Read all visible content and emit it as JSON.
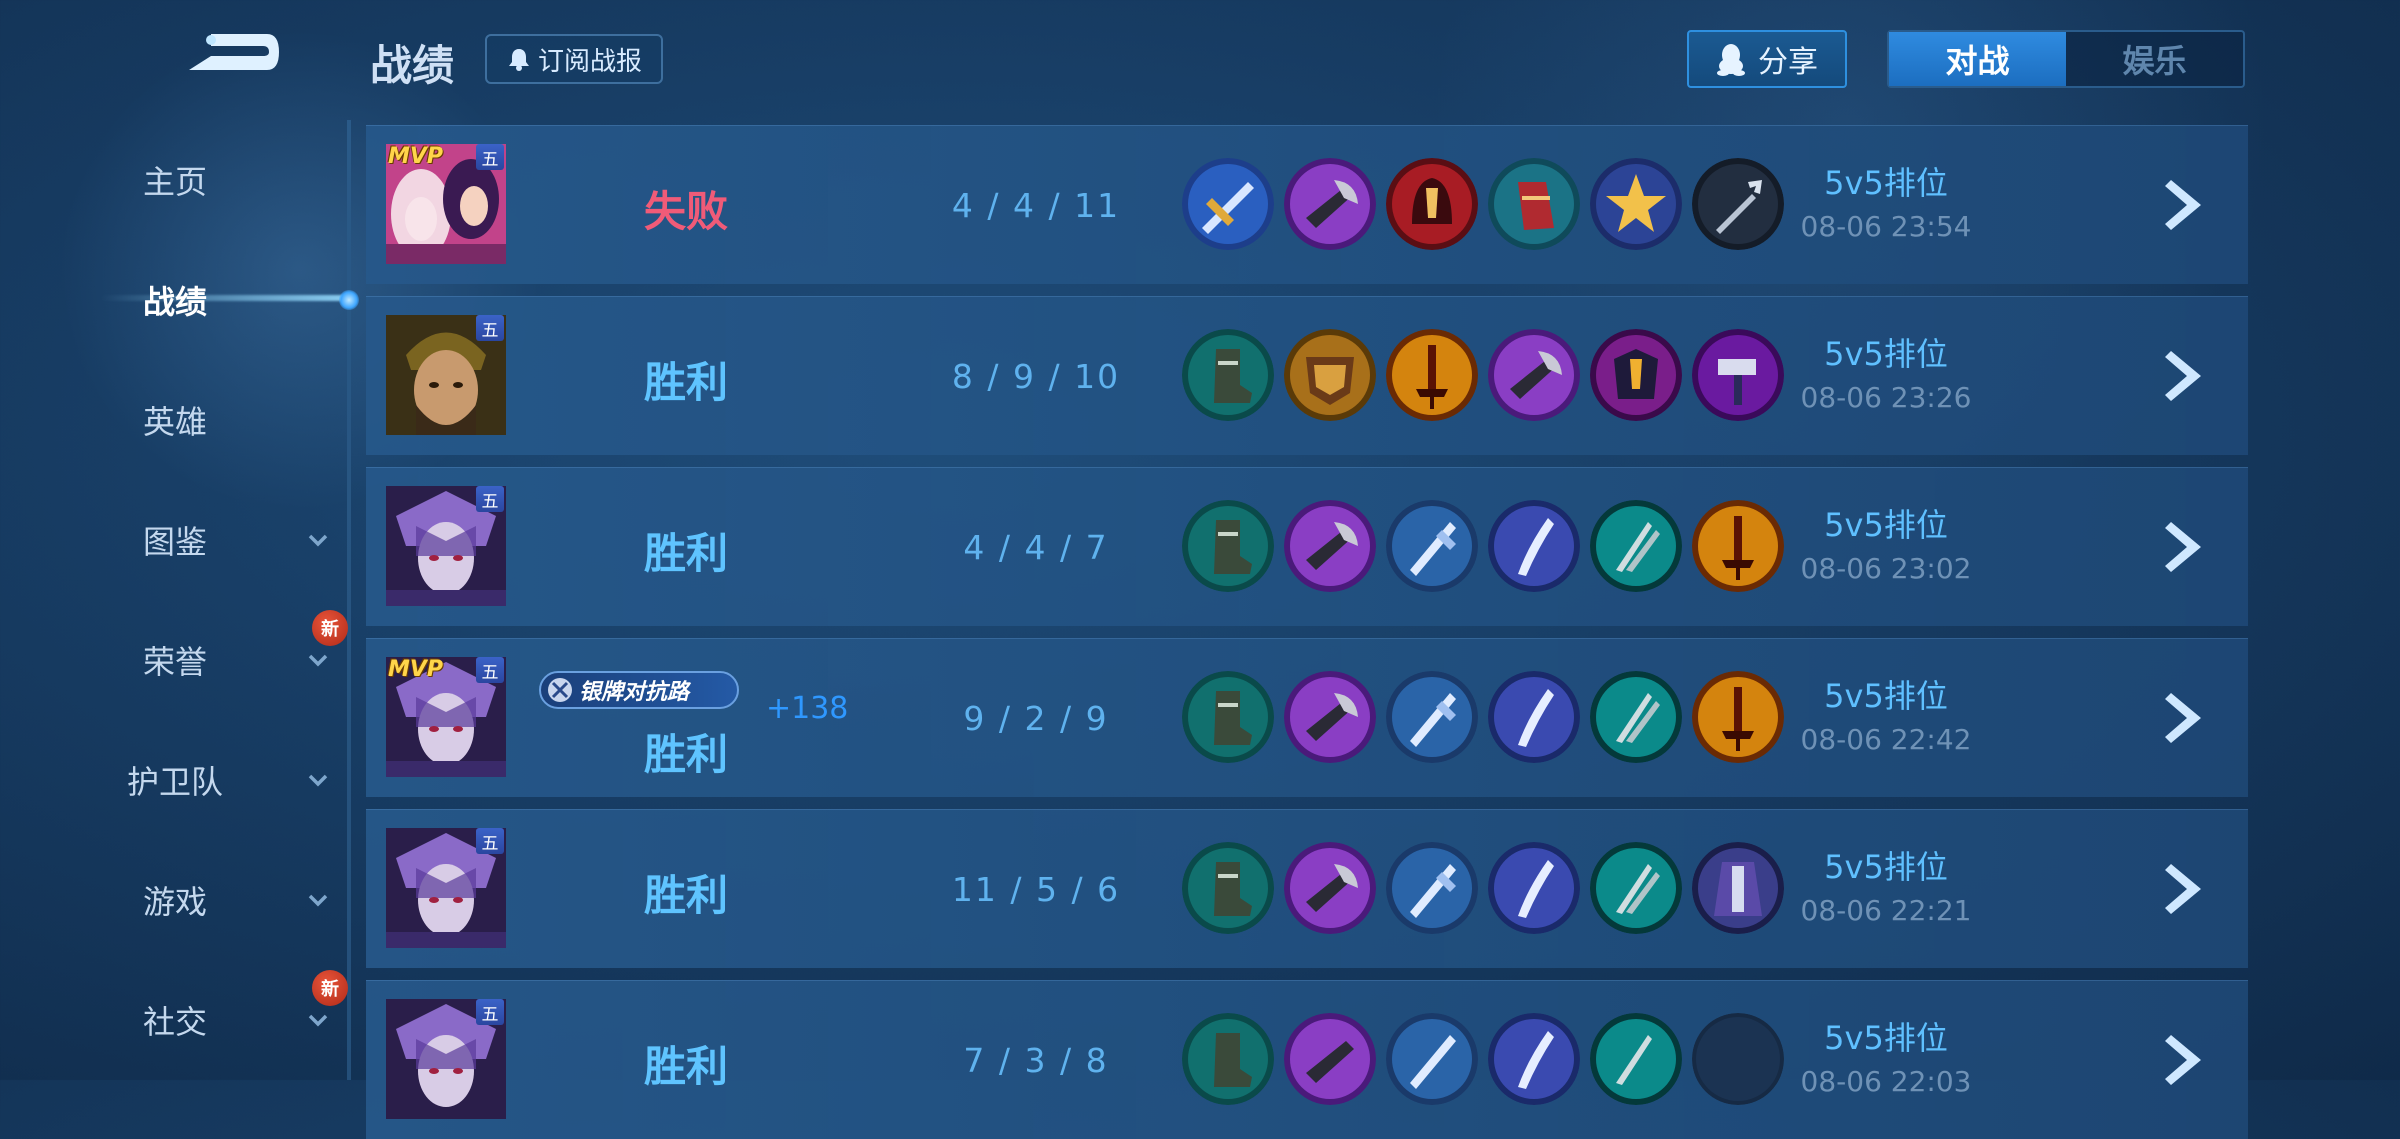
{
  "header": {
    "title": "战绩",
    "subscribe_label": "订阅战报",
    "share_label": "分享",
    "tabs": [
      {
        "label": "对战",
        "active": true
      },
      {
        "label": "娱乐",
        "active": false
      }
    ]
  },
  "sidebar": {
    "items": [
      {
        "label": "主页",
        "active": false,
        "has_dropdown": false,
        "new": false
      },
      {
        "label": "战绩",
        "active": true,
        "has_dropdown": false,
        "new": false
      },
      {
        "label": "英雄",
        "active": false,
        "has_dropdown": false,
        "new": false
      },
      {
        "label": "图鉴",
        "active": false,
        "has_dropdown": true,
        "new": false
      },
      {
        "label": "荣誉",
        "active": false,
        "has_dropdown": true,
        "new": true
      },
      {
        "label": "护卫队",
        "active": false,
        "has_dropdown": true,
        "new": false
      },
      {
        "label": "游戏",
        "active": false,
        "has_dropdown": true,
        "new": false
      },
      {
        "label": "社交",
        "active": false,
        "has_dropdown": true,
        "new": true
      }
    ],
    "new_badge_label": "新"
  },
  "matches": [
    {
      "result": "失败",
      "outcome": "lose",
      "kda": "4 / 4 / 11",
      "mode": "5v5排位",
      "time": "08-06 23:54",
      "mvp": true,
      "rank": "五",
      "hero": "mage-female",
      "items": [
        "blue-gold-blade",
        "purple-axe",
        "red-helmet",
        "red-gauntlet",
        "gold-star-shield",
        "dark-trident"
      ]
    },
    {
      "result": "胜利",
      "outcome": "win",
      "kda": "8 / 9 / 10",
      "mode": "5v5排位",
      "time": "08-06 23:26",
      "mvp": false,
      "rank": "五",
      "hero": "warrior-guan",
      "items": [
        "teal-boots",
        "gold-shield",
        "gold-sword",
        "purple-axe",
        "purple-armor",
        "purple-hammer"
      ]
    },
    {
      "result": "胜利",
      "outcome": "win",
      "kda": "4 / 4 / 7",
      "mode": "5v5排位",
      "time": "08-06 23:02",
      "mvp": false,
      "rank": "五",
      "hero": "purple-assassin",
      "items": [
        "teal-boots",
        "purple-axe",
        "blue-spear",
        "blue-blade",
        "teal-claw",
        "gold-sword"
      ]
    },
    {
      "result": "胜利",
      "outcome": "win",
      "kda": "9 / 2 / 9",
      "mode": "5v5排位",
      "time": "08-06 22:42",
      "mvp": true,
      "rank": "五",
      "hero": "purple-assassin",
      "badge": "银牌对抗路",
      "delta": "+138",
      "items": [
        "teal-boots",
        "purple-axe",
        "blue-spear",
        "blue-blade",
        "teal-claw",
        "gold-sword"
      ]
    },
    {
      "result": "胜利",
      "outcome": "win",
      "kda": "11 / 5 / 6",
      "mode": "5v5排位",
      "time": "08-06 22:21",
      "mvp": false,
      "rank": "五",
      "hero": "purple-assassin",
      "items": [
        "teal-boots",
        "purple-axe",
        "blue-spear",
        "blue-blade",
        "teal-claw",
        "purple-cloak"
      ]
    },
    {
      "result": "胜利",
      "outcome": "win",
      "kda": "7 / 3 / 8",
      "mode": "5v5排位",
      "time": "08-06 22:03",
      "mvp": false,
      "rank": "五",
      "hero": "purple-assassin",
      "items": [
        "teal-boots",
        "purple-axe",
        "blue-spear",
        "blue-blade",
        "teal-claw",
        "empty-slot"
      ]
    }
  ],
  "colors": {
    "win": "#5fc4ff",
    "lose": "#f05b78",
    "accent": "#2f8be0",
    "mvp": "#ffd54a"
  }
}
